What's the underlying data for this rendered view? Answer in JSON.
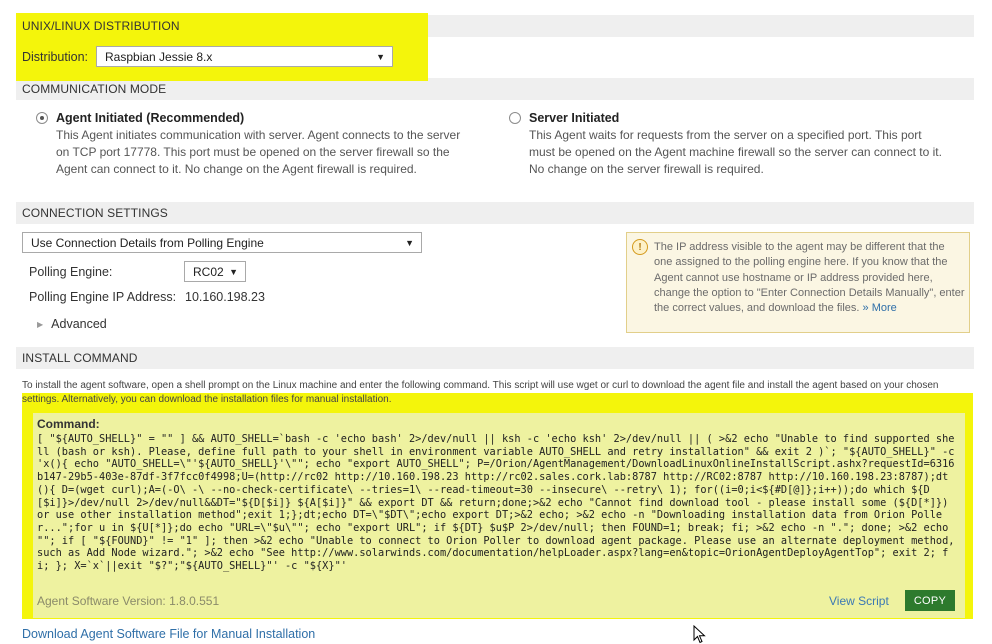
{
  "distribution_section": {
    "title": "UNIX/LINUX DISTRIBUTION",
    "label": "Distribution:",
    "selected": "Raspbian Jessie 8.x"
  },
  "communication_section": {
    "title": "COMMUNICATION MODE",
    "agent_initiated": {
      "title": "Agent Initiated (Recommended)",
      "lines": [
        "This Agent initiates communication with server. Agent connects to the server",
        "on TCP port 17778. This port must be opened on the server firewall so the",
        "Agent can connect to it. No change on the Agent firewall is required."
      ],
      "selected": true
    },
    "server_initiated": {
      "title": "Server Initiated",
      "lines": [
        "This Agent waits for requests from the server on a specified port. This port",
        "must be opened on the Agent machine firewall so the server can connect to it.",
        "No change on the server firewall is required."
      ],
      "selected": false
    }
  },
  "connection_section": {
    "title": "CONNECTION SETTINGS",
    "details_select": "Use Connection Details from Polling Engine",
    "polling_engine_label": "Polling Engine:",
    "polling_engine_value": "RC02",
    "ip_label": "Polling Engine IP Address:",
    "ip_value": "10.160.198.23",
    "advanced_label": "Advanced",
    "info_text": "The IP address visible to the agent may be different that the one assigned to the polling engine here. If you know that the Agent cannot use hostname or IP address provided here, change the option to \"Enter Connection Details Manually\", enter the correct values, and download the files.",
    "info_more": "» More"
  },
  "install_section": {
    "title": "INSTALL COMMAND",
    "instructions": "To install the agent software, open a shell prompt on the Linux machine and enter the following command. This script will use wget or curl to download the agent file and install the agent based on your chosen settings. Alternatively, you can download the installation files for manual installation.",
    "command_label": "Command:",
    "command_text": "[ \"${AUTO_SHELL}\" = \"\" ] && AUTO_SHELL=`bash -c 'echo bash' 2>/dev/null || ksh -c 'echo ksh' 2>/dev/null || ( >&2 echo \"Unable to find supported shell (bash or ksh). Please, define full path to your shell in environment variable AUTO_SHELL and retry installation\" && exit 2 )`; \"${AUTO_SHELL}\" -c 'x(){ echo \"AUTO_SHELL=\\\"'${AUTO_SHELL}'\\\"\"; echo \"export AUTO_SHELL\"; P=/Orion/AgentManagement/DownloadLinuxOnlineInstallScript.ashx?requestId=6316b147-29b5-403e-87df-3f7fcc0f4998;U=(http://rc02 http://10.160.198.23 http://rc02.sales.cork.lab:8787 http://RC02:8787 http://10.160.198.23:8787);dt(){ D=(wget curl);A=(-O\\ -\\ --no-check-certificate\\ --tries=1\\ --read-timeout=30 --insecure\\ --retry\\ 1); for((i=0;i<${#D[@]};i++));do which ${D[$i]}>/dev/null 2>/dev/null&&DT=\"${D[$i]} ${A[$i]}\" && export DT && return;done;>&2 echo \"Cannot find download tool - please install some (${D[*]}) or use other installation method\";exit 1;};dt;echo DT=\\\"$DT\\\";echo export DT;>&2 echo; >&2 echo -n \"Downloading installation data from Orion Poller...\";for u in ${U[*]};do echo \"URL=\\\"$u\\\"\"; echo \"export URL\"; if ${DT} $u$P 2>/dev/null; then FOUND=1; break; fi; >&2 echo -n \".\"; done; >&2 echo \"\"; if [ \"${FOUND}\" != \"1\" ]; then >&2 echo \"Unable to connect to Orion Poller to download agent package. Please use an alternate deployment method, such as Add Node wizard.\"; >&2 echo \"See http://www.solarwinds.com/documentation/helpLoader.aspx?lang=en&topic=OrionAgentDeployAgentTop\"; exit 2; fi; }; X=`x`||exit \"$?\";\"${AUTO_SHELL}\"' -c \"${X}\"'",
    "version": "Agent Software Version: 1.8.0.551",
    "view_script": "View Script",
    "copy": "COPY"
  },
  "download_link": "Download Agent Software File for Manual Installation",
  "colors": {
    "highlight": "#f4f50b",
    "link": "#2f6fa8",
    "copy_button": "#2d7a2d",
    "section_bar": "#efefef"
  }
}
